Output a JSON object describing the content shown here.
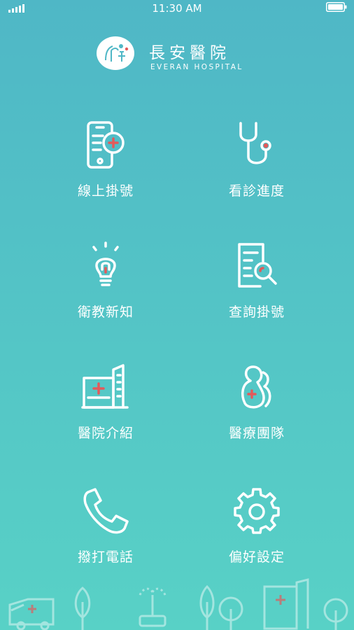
{
  "status_bar": {
    "time": "11:30 AM",
    "signal_icon": "signal-icon",
    "battery_icon": "battery-icon"
  },
  "brand": {
    "name_cn": "長安醫院",
    "name_en": "EVERAN HOSPITAL"
  },
  "menu": [
    {
      "label": "線上掛號",
      "icon": "phone-medical-icon"
    },
    {
      "label": "看診進度",
      "icon": "stethoscope-icon"
    },
    {
      "label": "衛教新知",
      "icon": "lightbulb-icon"
    },
    {
      "label": "查詢掛號",
      "icon": "document-search-icon"
    },
    {
      "label": "醫院介紹",
      "icon": "hospital-building-icon"
    },
    {
      "label": "醫療團隊",
      "icon": "doctor-team-icon"
    },
    {
      "label": "撥打電話",
      "icon": "telephone-icon"
    },
    {
      "label": "偏好設定",
      "icon": "gear-icon"
    }
  ],
  "colors": {
    "gradient_top": "#4fb7c6",
    "gradient_bottom": "#58d1c6",
    "accent_red": "#e35a5a"
  }
}
